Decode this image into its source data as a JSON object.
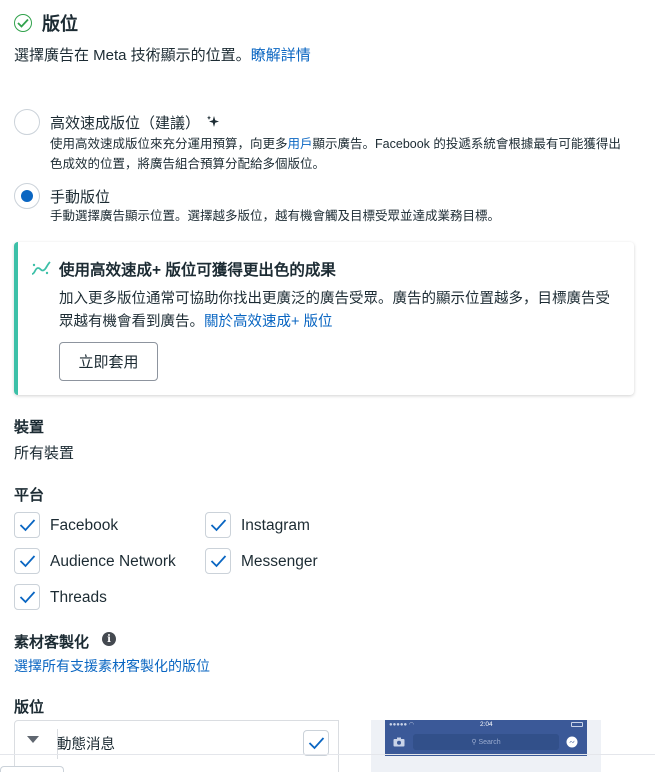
{
  "header": {
    "title": "版位",
    "description": "選擇廣告在 Meta 技術顯示的位置。",
    "learn_more": "瞭解詳情"
  },
  "options": {
    "advantage": {
      "label": "高效速成版位（建議）",
      "desc_prefix": "使用高效速成版位來充分運用預算，向更多",
      "desc_link": "用戶",
      "desc_suffix": "顯示廣告。Facebook 的投遞系統會根據最有可能獲得出色成效的位置，將廣告組合預算分配給多個版位。",
      "selected": false
    },
    "manual": {
      "label": "手動版位",
      "desc": "手動選擇廣告顯示位置。選擇越多版位，越有機會觸及目標受眾並達成業務目標。",
      "selected": true
    }
  },
  "banner": {
    "title": "使用高效速成+ 版位可獲得更出色的成果",
    "text": "加入更多版位通常可協助你找出更廣泛的廣告受眾。廣告的顯示位置越多，目標廣告受眾越有機會看到廣告。",
    "link": "關於高效速成+ 版位",
    "button": "立即套用",
    "accent_color": "#3dc0a8"
  },
  "devices": {
    "heading": "裝置",
    "value": "所有裝置"
  },
  "platforms": {
    "heading": "平台",
    "items": [
      {
        "label": "Facebook",
        "checked": true
      },
      {
        "label": "Instagram",
        "checked": true
      },
      {
        "label": "Audience Network",
        "checked": true
      },
      {
        "label": "Messenger",
        "checked": true
      },
      {
        "label": "Threads",
        "checked": true
      }
    ]
  },
  "asset_customization": {
    "heading": "素材客製化",
    "link": "選擇所有支援素材客製化的版位"
  },
  "placements": {
    "heading": "版位",
    "group_label": "動態消息",
    "group_checked": true
  },
  "preview": {
    "time": "2:04",
    "search_placeholder": "Search"
  },
  "colors": {
    "link": "#0a66c2",
    "check": "#0a66c2",
    "text": "#1c2b33",
    "success": "#31a24c"
  }
}
